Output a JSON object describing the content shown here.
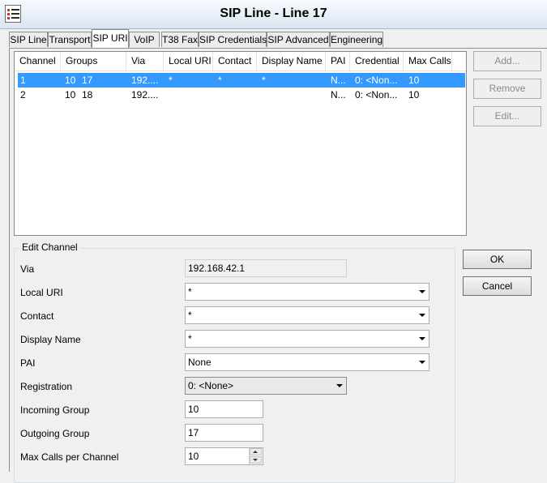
{
  "window": {
    "title": "SIP Line - Line 17",
    "icon": "list-icon"
  },
  "tabs": [
    {
      "label": "SIP Line"
    },
    {
      "label": "Transport"
    },
    {
      "label": "SIP URI"
    },
    {
      "label": "VoIP"
    },
    {
      "label": "T38 Fax"
    },
    {
      "label": "SIP Credentials"
    },
    {
      "label": "SIP Advanced"
    },
    {
      "label": "Engineering"
    }
  ],
  "active_tab": "SIP URI",
  "grid": {
    "columns": [
      "Channel",
      "Groups",
      "Via",
      "Local URI",
      "Contact",
      "Display Name",
      "PAI",
      "Credential",
      "Max Calls"
    ],
    "rows": [
      {
        "channel": "1",
        "groups_in": "10",
        "groups_out": "17",
        "via": "192....",
        "local_uri": "*",
        "contact": "*",
        "display_name": "*",
        "pai": "N...",
        "credential": "0: <Non...",
        "max_calls": "10"
      },
      {
        "channel": "2",
        "groups_in": "10",
        "groups_out": "18",
        "via": "192....",
        "local_uri": "",
        "contact": "",
        "display_name": "",
        "pai": "N...",
        "credential": "0: <Non...",
        "max_calls": "10"
      }
    ],
    "selected_row": 0
  },
  "side_buttons": {
    "add": "Add...",
    "remove": "Remove",
    "edit": "Edit..."
  },
  "edit_channel": {
    "legend": "Edit Channel",
    "via_label": "Via",
    "via_value": "192.168.42.1",
    "local_uri_label": "Local URI",
    "local_uri_value": "*",
    "contact_label": "Contact",
    "contact_value": "*",
    "display_name_label": "Display Name",
    "display_name_value": "*",
    "pai_label": "PAI",
    "pai_value": "None",
    "registration_label": "Registration",
    "registration_value": "0: <None>",
    "incoming_group_label": "Incoming Group",
    "incoming_group_value": "10",
    "outgoing_group_label": "Outgoing Group",
    "outgoing_group_value": "17",
    "max_calls_label": "Max Calls per Channel",
    "max_calls_value": "10"
  },
  "dialog_buttons": {
    "ok": "OK",
    "cancel": "Cancel"
  },
  "colors": {
    "selection": "#3399ff"
  }
}
